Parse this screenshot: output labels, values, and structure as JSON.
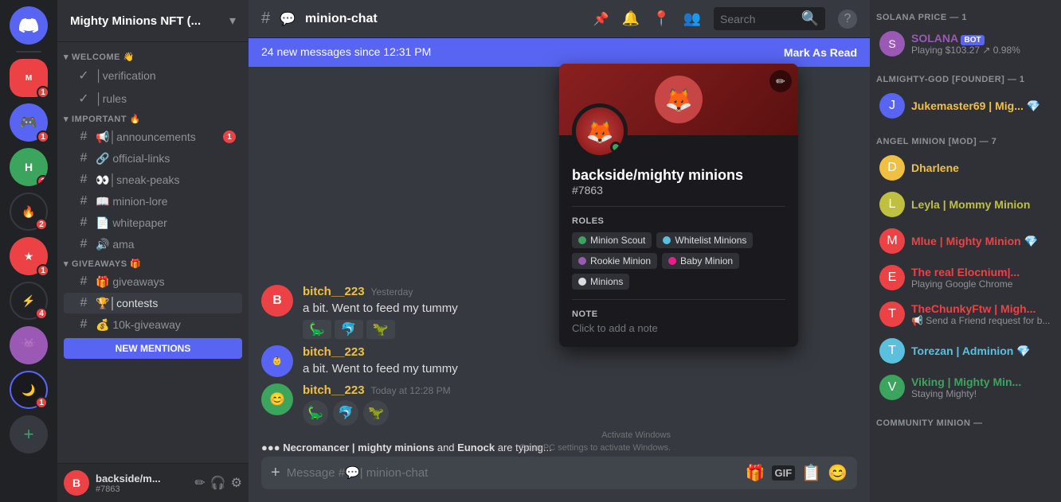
{
  "server": {
    "name": "Mighty Minions NFT (...",
    "icon_letter": "M"
  },
  "channels": {
    "welcome_category": "WELCOME 👋",
    "important_category": "IMPORTANT 🔥",
    "giveaways_category": "GIVEAWAYS 🎁",
    "items": [
      {
        "id": "verification",
        "icon": "✓",
        "name": "│verification",
        "active": false,
        "category": "welcome"
      },
      {
        "id": "rules",
        "icon": "✓",
        "name": "│rules",
        "active": false,
        "category": "welcome"
      },
      {
        "id": "announcements",
        "icon": "📢",
        "name": "│announcements",
        "active": false,
        "category": "important",
        "badge": "1"
      },
      {
        "id": "official-links",
        "icon": "🔗",
        "name": "official-links",
        "active": false,
        "category": "important"
      },
      {
        "id": "sneak-peaks",
        "icon": "👀",
        "name": "sneak-peaks",
        "active": false,
        "category": "important"
      },
      {
        "id": "minion-lore",
        "icon": "📖",
        "name": "minion-lore",
        "active": false,
        "category": "important"
      },
      {
        "id": "whitepaper",
        "icon": "📄",
        "name": "whitepaper",
        "active": false,
        "category": "important"
      },
      {
        "id": "ama",
        "icon": "🔊",
        "name": "ama",
        "active": false,
        "category": "important"
      },
      {
        "id": "giveaways",
        "icon": "🎁",
        "name": "giveaways",
        "active": false,
        "category": "giveaways"
      },
      {
        "id": "contests",
        "icon": "🏆",
        "name": "│contests",
        "active": true,
        "category": "giveaways"
      },
      {
        "id": "10k-giveaway",
        "icon": "💰",
        "name": "10k-giveaway",
        "active": false,
        "category": "giveaways"
      }
    ]
  },
  "current_channel": {
    "name": "minion-chat",
    "topic": "minion-chat"
  },
  "new_messages_bar": {
    "text": "24 new messages since 12:31 PM",
    "action": "Mark As Read"
  },
  "toolbar": {
    "search_placeholder": "Search"
  },
  "profile_popup": {
    "username": "backside/mighty minions",
    "tag": "#7863",
    "roles_label": "ROLES",
    "roles": [
      {
        "name": "Minion Scout",
        "color": "#3ba55d"
      },
      {
        "name": "Whitelist Minions",
        "color": "#5bc0de"
      },
      {
        "name": "Rookie Minion",
        "color": "#9b59b6"
      },
      {
        "name": "Baby Minion",
        "color": "#e91e8c"
      },
      {
        "name": "Minions",
        "color": "#dcddde"
      }
    ],
    "note_label": "NOTE",
    "note_placeholder": "Click to add a note"
  },
  "messages": [
    {
      "author": "bitch__223",
      "timestamp": "Today at 12:28 PM",
      "text": ""
    }
  ],
  "chat_input": {
    "placeholder": "Message #💬| minion-chat"
  },
  "typing": {
    "text": "● ● ● Necromancer | mighty minions and Eunock are typing..."
  },
  "members": {
    "solana_category": "SOLANA PRICE — 1",
    "almighty_category": "ALMIGHTY-GOD [FOUNDER] — 1",
    "angel_category": "ANGEL MINION [MOD] — 7",
    "community_category": "COMMUNITY MINION —",
    "list": [
      {
        "name": "SOLANA",
        "badge": "BOT",
        "status": "Playing $103.27 ↗ 0.98%",
        "color": "#9b59b6",
        "category": "solana",
        "gem": false
      },
      {
        "name": "Jukemaster69 | Mig...",
        "status": "",
        "color": "#5865f2",
        "category": "almighty",
        "gem": true
      },
      {
        "name": "Dharlene",
        "status": "",
        "color": "#f0c040",
        "category": "angel",
        "gem": false
      },
      {
        "name": "Leyla | Mommy Minion",
        "status": "",
        "color": "#c0c040",
        "category": "angel",
        "gem": false
      },
      {
        "name": "Mlue | Mighty Minion",
        "status": "",
        "color": "#ed4245",
        "category": "angel",
        "gem": true
      },
      {
        "name": "The real Elocnium|...",
        "status": "Playing Google Chrome",
        "color": "#ed4245",
        "category": "angel",
        "gem": false
      },
      {
        "name": "TheChunkyFtw | Migh...",
        "status": "📢 Send a Friend request for b...",
        "color": "#ed4245",
        "category": "angel",
        "gem": false
      },
      {
        "name": "Torezan | Adminion",
        "status": "",
        "color": "#5bc0de",
        "category": "angel",
        "gem": true
      },
      {
        "name": "Viking | Mighty Min...",
        "status": "Staying Mighty!",
        "color": "#3ba55d",
        "category": "angel",
        "gem": false
      }
    ]
  },
  "bottom_user": {
    "name": "backside/m...",
    "tag": "#7863"
  },
  "activation": {
    "line1": "Activate Windows",
    "line2": "Go to PC settings to activate Windows."
  }
}
